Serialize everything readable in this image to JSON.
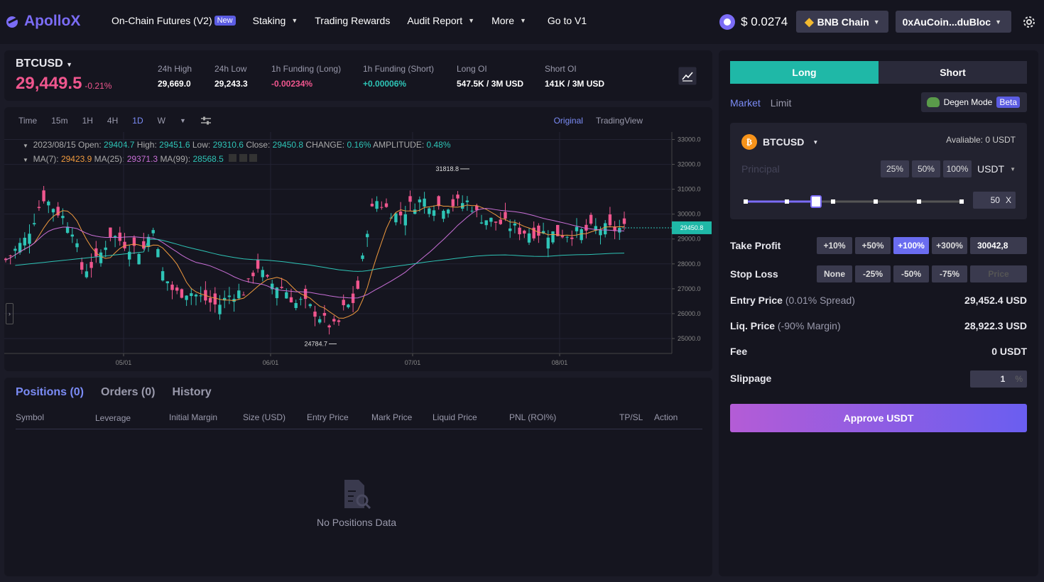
{
  "brand": {
    "name": "ApolloX"
  },
  "nav": {
    "futures": "On-Chain Futures (V2)",
    "new_badge": "New",
    "staking": "Staking",
    "rewards": "Trading Rewards",
    "audit": "Audit Report",
    "more": "More",
    "v1": "Go to V1"
  },
  "header": {
    "token_price": "$ 0.0274",
    "chain": "BNB Chain",
    "wallet": "0xAuCoin...duBloc"
  },
  "ticker": {
    "symbol": "BTCUSD",
    "price": "29,449.5",
    "change": "-0.21%",
    "stats": [
      {
        "label": "24h High",
        "value": "29,669.0"
      },
      {
        "label": "24h Low",
        "value": "29,243.3"
      },
      {
        "label": "1h Funding (Long)",
        "value": "-0.00234%"
      },
      {
        "label": "1h Funding (Short)",
        "value": "+0.00006%"
      },
      {
        "label": "Long OI",
        "value": "547.5K / 3M USD"
      },
      {
        "label": "Short OI",
        "value": "141K / 3M USD"
      }
    ]
  },
  "chart_tools": {
    "time": "Time",
    "i1": "15m",
    "i2": "1H",
    "i3": "4H",
    "i4": "1D",
    "i5": "W",
    "original": "Original",
    "tradingview": "TradingView"
  },
  "legend": {
    "date": "2023/08/15",
    "open_l": "Open:",
    "open": "29404.7",
    "high_l": "High:",
    "high": "29451.6",
    "low_l": "Low:",
    "low": "29310.6",
    "close_l": "Close:",
    "close": "29450.8",
    "change_l": "CHANGE:",
    "change": "0.16%",
    "amp_l": "AMPLITUDE:",
    "amp": "0.48%",
    "ma7_l": "MA(7):",
    "ma7": "29423.9",
    "ma25_l": "MA(25):",
    "ma25": "29371.3",
    "ma99_l": "MA(99):",
    "ma99": "28568.5"
  },
  "chart_data": {
    "type": "candlestick",
    "y_ticks": [
      "33000.0",
      "32000.0",
      "31000.0",
      "30000.0",
      "29000.0",
      "28000.0",
      "27000.0",
      "26000.0",
      "25000.0"
    ],
    "x_ticks": [
      "05/01",
      "06/01",
      "07/01",
      "08/01"
    ],
    "current_price": "29450.8",
    "max_label": "31818.8",
    "min_label": "24784.7",
    "ylim": [
      24400,
      33300
    ]
  },
  "positions": {
    "tab_positions": "Positions (0)",
    "tab_orders": "Orders (0)",
    "tab_history": "History",
    "cols": [
      "Symbol",
      "Leverage",
      "Initial Margin",
      "Size (USD)",
      "Entry Price",
      "Mark Price",
      "Liquid Price",
      "PNL (ROI%)",
      "TP/SL",
      "Action"
    ],
    "empty": "No Positions Data"
  },
  "order": {
    "long": "Long",
    "short": "Short",
    "market": "Market",
    "limit": "Limit",
    "degen": "Degen Mode",
    "beta": "Beta",
    "symbol": "BTCUSD",
    "available": "Avaliable: 0 USDT",
    "principal_placeholder": "Principal",
    "p25": "25%",
    "p50": "50%",
    "p100": "100%",
    "currency": "USDT",
    "leverage": "50",
    "leverage_x": "X",
    "take_profit": "Take Profit",
    "tp_opts": [
      "+10%",
      "+50%",
      "+100%",
      "+300%"
    ],
    "tp_value": "30042,8",
    "stop_loss": "Stop Loss",
    "sl_opts": [
      "None",
      "-25%",
      "-50%",
      "-75%"
    ],
    "sl_placeholder": "Price",
    "entry_label": "Entry Price",
    "entry_note": "(0.01% Spread)",
    "entry_value": "29,452.4 USD",
    "liq_label": "Liq. Price",
    "liq_note": "(-90% Margin)",
    "liq_value": "28,922.3 USD",
    "fee_label": "Fee",
    "fee_value": "0 USDT",
    "slippage_label": "Slippage",
    "slippage_value": "1",
    "slippage_unit": "%",
    "approve": "Approve USDT"
  }
}
